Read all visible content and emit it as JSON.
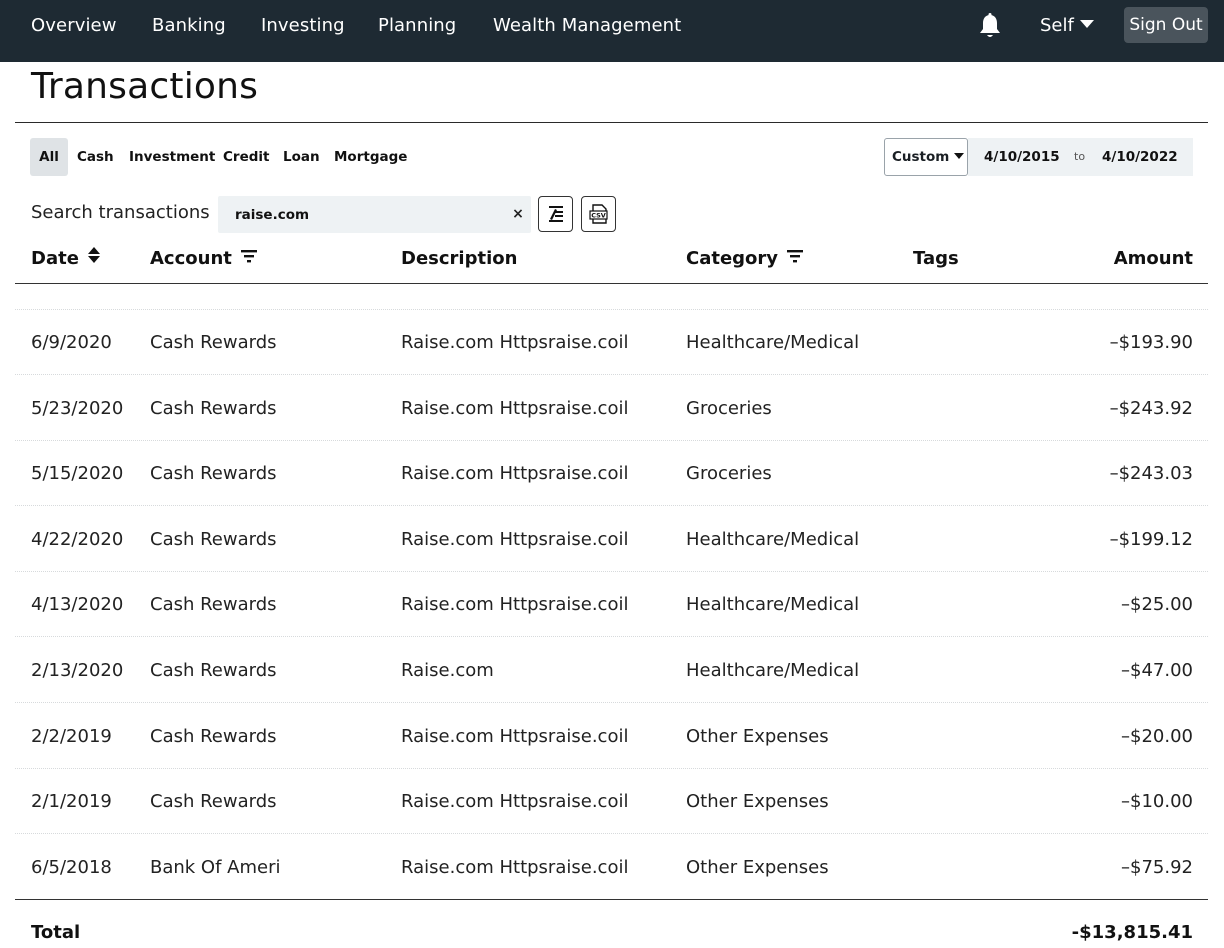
{
  "nav": {
    "links": [
      "Overview",
      "Banking",
      "Investing",
      "Planning",
      "Wealth Management"
    ],
    "notifications_icon": "bell-icon",
    "user_menu_label": "Self",
    "sign_out_label": "Sign Out"
  },
  "page": {
    "title": "Transactions"
  },
  "filters": {
    "account_types": [
      "All",
      "Cash",
      "Investment",
      "Credit",
      "Loan",
      "Mortgage"
    ],
    "selected_account_type": "All",
    "range_select": "Custom",
    "date_from": "4/10/2015",
    "date_separator": "to",
    "date_to": "4/10/2022"
  },
  "search": {
    "label": "Search transactions",
    "value": "raise.com",
    "clear_glyph": "×",
    "edit_icon": "edit-list-icon",
    "export_icon": "csv-export-icon"
  },
  "table": {
    "headers": {
      "date": "Date",
      "account": "Account",
      "description": "Description",
      "category": "Category",
      "tags": "Tags",
      "amount": "Amount"
    },
    "rows": [
      {
        "date": "6/9/2020",
        "account": "Cash Rewards",
        "description": "Raise.com Httpsraise.coil",
        "category": "Healthcare/Medical",
        "tags": "",
        "amount": "–$193.90"
      },
      {
        "date": "5/23/2020",
        "account": "Cash Rewards",
        "description": "Raise.com Httpsraise.coil",
        "category": "Groceries",
        "tags": "",
        "amount": "–$243.92"
      },
      {
        "date": "5/15/2020",
        "account": "Cash Rewards",
        "description": "Raise.com Httpsraise.coil",
        "category": "Groceries",
        "tags": "",
        "amount": "–$243.03"
      },
      {
        "date": "4/22/2020",
        "account": "Cash Rewards",
        "description": "Raise.com Httpsraise.coil",
        "category": "Healthcare/Medical",
        "tags": "",
        "amount": "–$199.12"
      },
      {
        "date": "4/13/2020",
        "account": "Cash Rewards",
        "description": "Raise.com Httpsraise.coil",
        "category": "Healthcare/Medical",
        "tags": "",
        "amount": "–$25.00"
      },
      {
        "date": "2/13/2020",
        "account": "Cash Rewards",
        "description": "Raise.com",
        "category": "Healthcare/Medical",
        "tags": "",
        "amount": "–$47.00"
      },
      {
        "date": "2/2/2019",
        "account": "Cash Rewards",
        "description": "Raise.com Httpsraise.coil",
        "category": "Other Expenses",
        "tags": "",
        "amount": "–$20.00"
      },
      {
        "date": "2/1/2019",
        "account": "Cash Rewards",
        "description": "Raise.com Httpsraise.coil",
        "category": "Other Expenses",
        "tags": "",
        "amount": "–$10.00"
      },
      {
        "date": "6/5/2018",
        "account": "Bank Of Ameri",
        "description": "Raise.com Httpsraise.coil",
        "category": "Other Expenses",
        "tags": "",
        "amount": "–$75.92"
      }
    ]
  },
  "totals": {
    "label": "Total",
    "value": "-$13,815.41"
  },
  "colors": {
    "nav_bg": "#1e2a33",
    "sign_out_bg": "#4a545c",
    "input_bg": "#eef2f4",
    "active_tab_bg": "#dfe3e6"
  }
}
